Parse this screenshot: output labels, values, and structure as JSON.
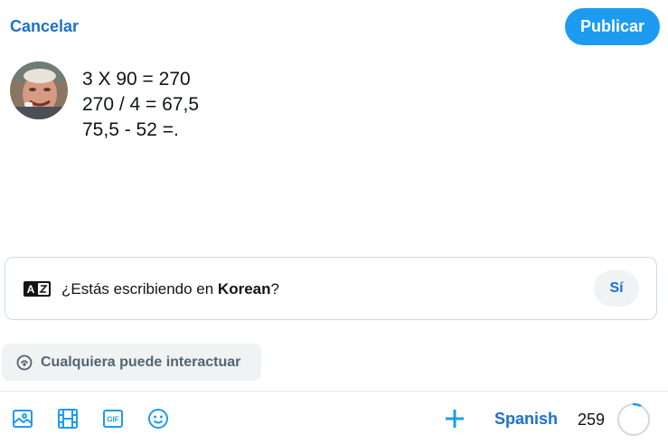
{
  "header": {
    "cancel_label": "Cancelar",
    "publish_label": "Publicar"
  },
  "post": {
    "lines": [
      "3 X 90 = 270",
      "270 / 4 = 67,5",
      "75,5 - 52 =."
    ]
  },
  "language_prompt": {
    "question_prefix": "¿Estás escribiendo en ",
    "language": "Korean",
    "question_suffix": "?",
    "yes_label": "Sí",
    "icon": "translate-icon"
  },
  "reply_settings": {
    "label": "Cualquiera puede interactuar",
    "icon": "reply-settings-icon"
  },
  "toolbar": {
    "icons": [
      "image-icon",
      "video-icon",
      "gif-icon",
      "emoji-icon",
      "add-icon"
    ],
    "language_label": "Spanish",
    "char_count": "259",
    "char_progress": 0.07
  },
  "colors": {
    "accent": "#1d9bf0",
    "link": "#1d6fd0",
    "muted": "#536471",
    "border": "#cfd9de"
  }
}
